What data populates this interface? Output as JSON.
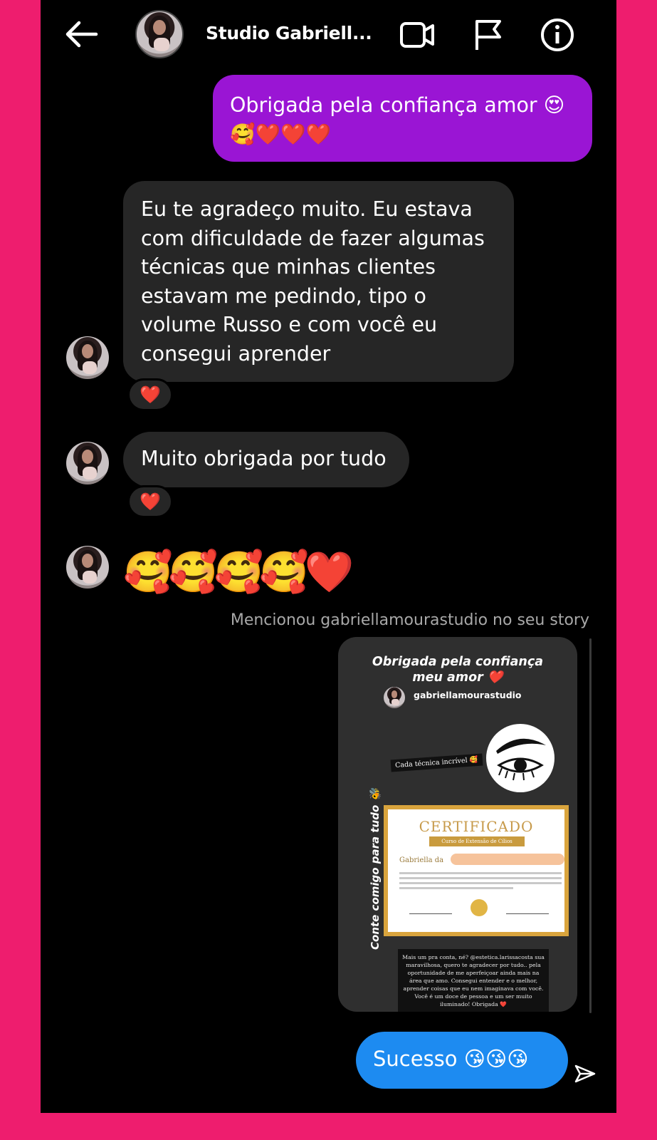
{
  "header": {
    "title": "Studio Gabriell...",
    "back_icon": "arrow-left-icon",
    "video_icon": "video-camera-icon",
    "flag_icon": "flag-icon",
    "info_icon": "info-icon"
  },
  "messages": {
    "sent_1": {
      "line1": "Obrigada pela confiança amor 😍",
      "line2": "🥰❤️❤️❤️"
    },
    "received_1": {
      "lines": [
        "Eu te agradeço muito. Eu estava",
        "com dificuldade de fazer algumas",
        "técnicas que minhas clientes",
        "estavam me pedindo, tipo o",
        "volume Russo e com você eu",
        "consegui aprender"
      ],
      "reaction": "❤️"
    },
    "received_2": {
      "text": "Muito obrigada por tudo",
      "reaction": "❤️"
    },
    "received_3": {
      "emoji": "🥰🥰🥰🥰❤️"
    },
    "mention_label": "Mencionou gabriellamourastudio no seu story",
    "story": {
      "title_line1": "Obrigada pela confiança",
      "title_line2": "meu amor ❤️",
      "username": "gabriellamourastudio",
      "sticker": "Cada técnica incrível 🥰",
      "side_text": "Conte comigo para tudo 🐝",
      "certificate": {
        "title": "CERTIFICADO",
        "subtitle": "Curso de Extensão de Cílios",
        "name": "Gabriella da"
      },
      "note": "Mais um pra conta, né? @estetica.larissacosta sua maravilhosa, quero te agradecer por tudo.. pela oportunidade de me aperfeiçoar ainda mais na área que amo. Consegui entender e o melhor, aprender coisas que eu nem imaginava com você. Você é um doce de pessoa e um ser muito iluminado! Obrigada ❤️"
    },
    "sent_2": {
      "text": "Sucesso 😘😘😘"
    },
    "sent_icon": "paper-plane-icon"
  },
  "colors": {
    "background_frame": "#EE1D6E",
    "sent_purple": "#9A15D4",
    "sent_blue": "#1D8BF1",
    "received_gray": "#262626"
  }
}
